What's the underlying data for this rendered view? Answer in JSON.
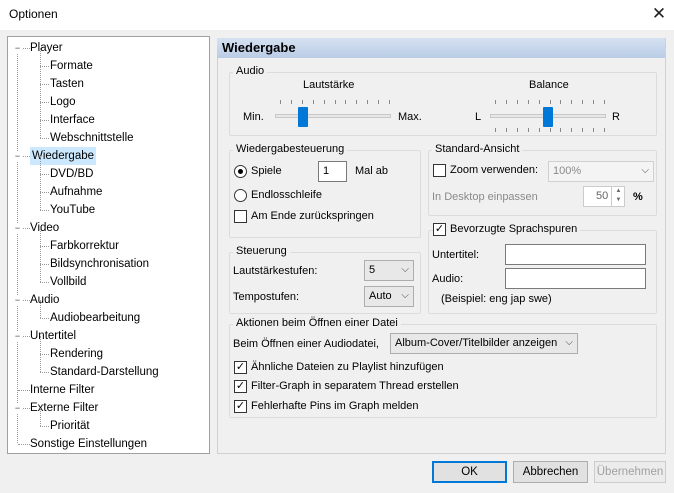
{
  "window": {
    "title": "Optionen",
    "close_glyph": "✕"
  },
  "tree": {
    "items": [
      {
        "label": "Player",
        "level": 0,
        "toggle": "−"
      },
      {
        "label": "Formate",
        "level": 1
      },
      {
        "label": "Tasten",
        "level": 1
      },
      {
        "label": "Logo",
        "level": 1
      },
      {
        "label": "Interface",
        "level": 1
      },
      {
        "label": "Webschnittstelle",
        "level": 1
      },
      {
        "label": "Wiedergabe",
        "level": 0,
        "toggle": "−",
        "selected": true
      },
      {
        "label": "DVD/BD",
        "level": 1
      },
      {
        "label": "Aufnahme",
        "level": 1
      },
      {
        "label": "YouTube",
        "level": 1
      },
      {
        "label": "Video",
        "level": 0,
        "toggle": "−"
      },
      {
        "label": "Farbkorrektur",
        "level": 1
      },
      {
        "label": "Bildsynchronisation",
        "level": 1
      },
      {
        "label": "Vollbild",
        "level": 1
      },
      {
        "label": "Audio",
        "level": 0,
        "toggle": "−"
      },
      {
        "label": "Audiobearbeitung",
        "level": 1
      },
      {
        "label": "Untertitel",
        "level": 0,
        "toggle": "−"
      },
      {
        "label": "Rendering",
        "level": 1
      },
      {
        "label": "Standard-Darstellung",
        "level": 1
      },
      {
        "label": "Interne Filter",
        "level": 0
      },
      {
        "label": "Externe Filter",
        "level": 0,
        "toggle": "−"
      },
      {
        "label": "Priorität",
        "level": 1
      },
      {
        "label": "Sonstige Einstellungen",
        "level": 0
      }
    ]
  },
  "panel": {
    "title": "Wiedergabe",
    "audio": {
      "legend": "Audio",
      "volume_label": "Lautstärke",
      "volume_min": "Min.",
      "volume_max": "Max.",
      "volume_value": 0.22,
      "balance_label": "Balance",
      "balance_left": "L",
      "balance_right": "R",
      "balance_value": 0.5
    },
    "playback_control": {
      "legend": "Wiedergabesteuerung",
      "play_label": "Spiele",
      "play_count": "1",
      "play_suffix": "Mal ab",
      "loop_label": "Endlosschleife",
      "rewind_label": "Am Ende zurückspringen"
    },
    "default_view": {
      "legend": "Standard-Ansicht",
      "zoom_label": "Zoom verwenden:",
      "zoom_value": "100%",
      "fit_label": "In Desktop einpassen",
      "fit_value": "50",
      "fit_unit": "%"
    },
    "control": {
      "legend": "Steuerung",
      "volume_steps_label": "Lautstärkestufen:",
      "volume_steps_value": "5",
      "tempo_steps_label": "Tempostufen:",
      "tempo_steps_value": "Auto"
    },
    "language_tracks": {
      "legend": "Bevorzugte Sprachspuren",
      "subtitle_label": "Untertitel:",
      "subtitle_value": "",
      "audio_label": "Audio:",
      "audio_value": "",
      "example": "(Beispiel: eng jap swe)"
    },
    "open_actions": {
      "legend": "Aktionen beim Öffnen einer Datei",
      "audio_file_label": "Beim Öffnen einer Audiodatei,",
      "audio_file_value": "Album-Cover/Titelbilder anzeigen",
      "similar_files": "Ähnliche Dateien zu Playlist hinzufügen",
      "filter_graph": "Filter-Graph in separatem Thread erstellen",
      "faulty_pins": "Fehlerhafte Pins im Graph melden"
    }
  },
  "buttons": {
    "ok": "OK",
    "cancel": "Abbrechen",
    "apply": "Übernehmen"
  },
  "glyphs": {
    "check": "✓",
    "chevron_down": "⌵",
    "spin_up": "▲",
    "spin_down": "▼"
  }
}
